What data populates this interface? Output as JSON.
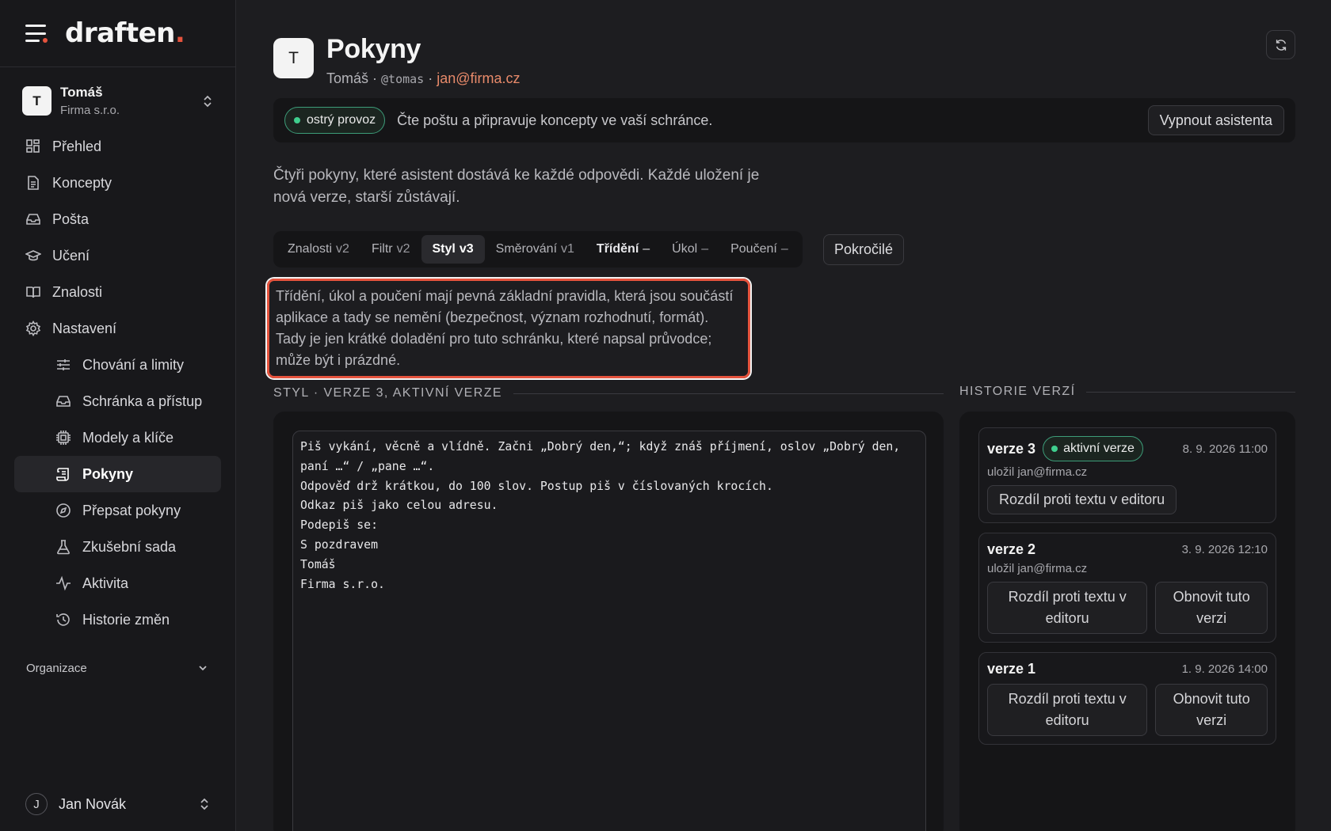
{
  "app": {
    "logo_text": "draften",
    "logo_dot": "."
  },
  "account": {
    "initial": "T",
    "name": "Tomáš",
    "company": "Firma s.r.o."
  },
  "nav": {
    "items": [
      {
        "label": "Přehled",
        "icon": "grid-icon"
      },
      {
        "label": "Koncepty",
        "icon": "document-icon"
      },
      {
        "label": "Pošta",
        "icon": "inbox-icon"
      },
      {
        "label": "Učení",
        "icon": "graduation-cap-icon"
      },
      {
        "label": "Znalosti",
        "icon": "book-icon"
      },
      {
        "label": "Nastavení",
        "icon": "gear-icon"
      }
    ],
    "sub_items": [
      {
        "label": "Chování a limity",
        "icon": "sliders-icon"
      },
      {
        "label": "Schránka a přístup",
        "icon": "inbox-icon"
      },
      {
        "label": "Modely a klíče",
        "icon": "chip-icon"
      },
      {
        "label": "Pokyny",
        "icon": "scroll-icon",
        "active": true
      },
      {
        "label": "Přepsat pokyny",
        "icon": "compass-icon"
      },
      {
        "label": "Zkušební sada",
        "icon": "flask-icon"
      },
      {
        "label": "Aktivita",
        "icon": "activity-icon"
      },
      {
        "label": "Historie změn",
        "icon": "history-icon"
      }
    ],
    "org_label": "Organizace"
  },
  "user": {
    "initial": "J",
    "name": "Jan Novák"
  },
  "header": {
    "initial": "T",
    "title": "Pokyny",
    "owner": "Tomáš",
    "handle": "@tomas",
    "email": "jan@firma.cz",
    "sep": " · "
  },
  "banner": {
    "status": "ostrý provoz",
    "text": "Čte poštu a připravuje koncepty ve vaší schránce.",
    "button": "Vypnout asistenta"
  },
  "intro": "Čtyři pokyny, které asistent dostává ke každé odpovědi. Každé uložení je nová verze, starší zůstávají.",
  "tabs": [
    {
      "label": "Znalosti",
      "version": "v2"
    },
    {
      "label": "Filtr",
      "version": "v2"
    },
    {
      "label": "Styl",
      "version": "v3",
      "selected": true
    },
    {
      "label": "Směrování",
      "version": "v1"
    },
    {
      "label": "Třídění",
      "version": "–"
    },
    {
      "label": "Úkol",
      "version": "–"
    },
    {
      "label": "Poučení",
      "version": "–"
    }
  ],
  "advanced_button": "Pokročilé",
  "note": "Třídění, úkol a poučení mají pevná základní pravidla, která jsou součástí aplikace a tady se nemění (bezpečnost, význam rozhodnutí, formát). Tady je jen krátké doladění pro tuto schránku, které napsal průvodce; může být i prázdné.",
  "editor": {
    "section_title": "STYL · VERZE 3, AKTIVNÍ VERZE",
    "content": "Piš vykání, věcně a vlídně. Začni „Dobrý den,“; když znáš příjmení, oslov „Dobrý den, paní …“ / „pane …“.\nOdpověď drž krátkou, do 100 slov. Postup piš v číslovaných krocích.\nOdkaz piš jako celou adresu.\nPodepiš se:\nS pozdravem\nTomáš\nFirma s.r.o."
  },
  "history": {
    "section_title": "HISTORIE VERZÍ",
    "versions": [
      {
        "name": "verze 3",
        "active_label": "aktivní verze",
        "date": "8. 9. 2026 11:00",
        "by": "uložil jan@firma.cz",
        "diff_button": "Rozdíl proti textu v editoru"
      },
      {
        "name": "verze 2",
        "date": "3. 9. 2026 12:10",
        "by": "uložil jan@firma.cz",
        "diff_button": "Rozdíl proti textu v editoru",
        "restore_button": "Obnovit tuto verzi"
      },
      {
        "name": "verze 1",
        "date": "1. 9. 2026 14:00",
        "diff_button": "Rozdíl proti textu v editoru",
        "restore_button": "Obnovit tuto verzi"
      }
    ]
  },
  "colors": {
    "accent": "#e5533d",
    "live_green": "#3fcf8e",
    "email": "#e88a6a"
  }
}
